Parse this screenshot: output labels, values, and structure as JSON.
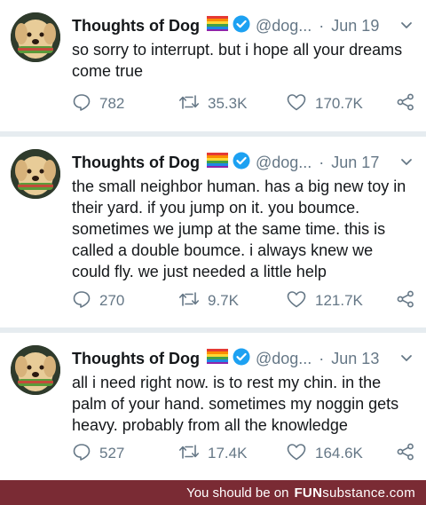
{
  "colors": {
    "link_gray": "#657786",
    "text": "#14171a",
    "verified_blue": "#1da1f2",
    "footer_bg": "#7a2b34"
  },
  "tweets": [
    {
      "name": "Thoughts of Dog",
      "handle": "@dog...",
      "date": "Jun 19",
      "text": "so sorry to interrupt. but i hope all your dreams come true",
      "replies": "782",
      "retweets": "35.3K",
      "likes": "170.7K"
    },
    {
      "name": "Thoughts of Dog",
      "handle": "@dog...",
      "date": "Jun 17",
      "text": "the small neighbor human. has a big new toy in their yard. if you jump on it. you boumce. sometimes we jump at the same time. this is called a double boumce. i always knew we could fly. we just needed a little help",
      "replies": "270",
      "retweets": "9.7K",
      "likes": "121.7K"
    },
    {
      "name": "Thoughts of Dog",
      "handle": "@dog...",
      "date": "Jun 13",
      "text": "all i need right now. is to rest my chin. in the palm of your hand. sometimes my noggin gets heavy. probably from all the knowledge",
      "replies": "527",
      "retweets": "17.4K",
      "likes": "164.6K"
    }
  ],
  "icons": [
    "rainbow-flag-icon",
    "verified-badge-icon",
    "chevron-down-icon",
    "reply-icon",
    "retweet-icon",
    "like-icon",
    "share-icon"
  ],
  "footer": {
    "text": "You should be on",
    "brand_bold": "FUN",
    "brand_rest": "substance.com"
  }
}
